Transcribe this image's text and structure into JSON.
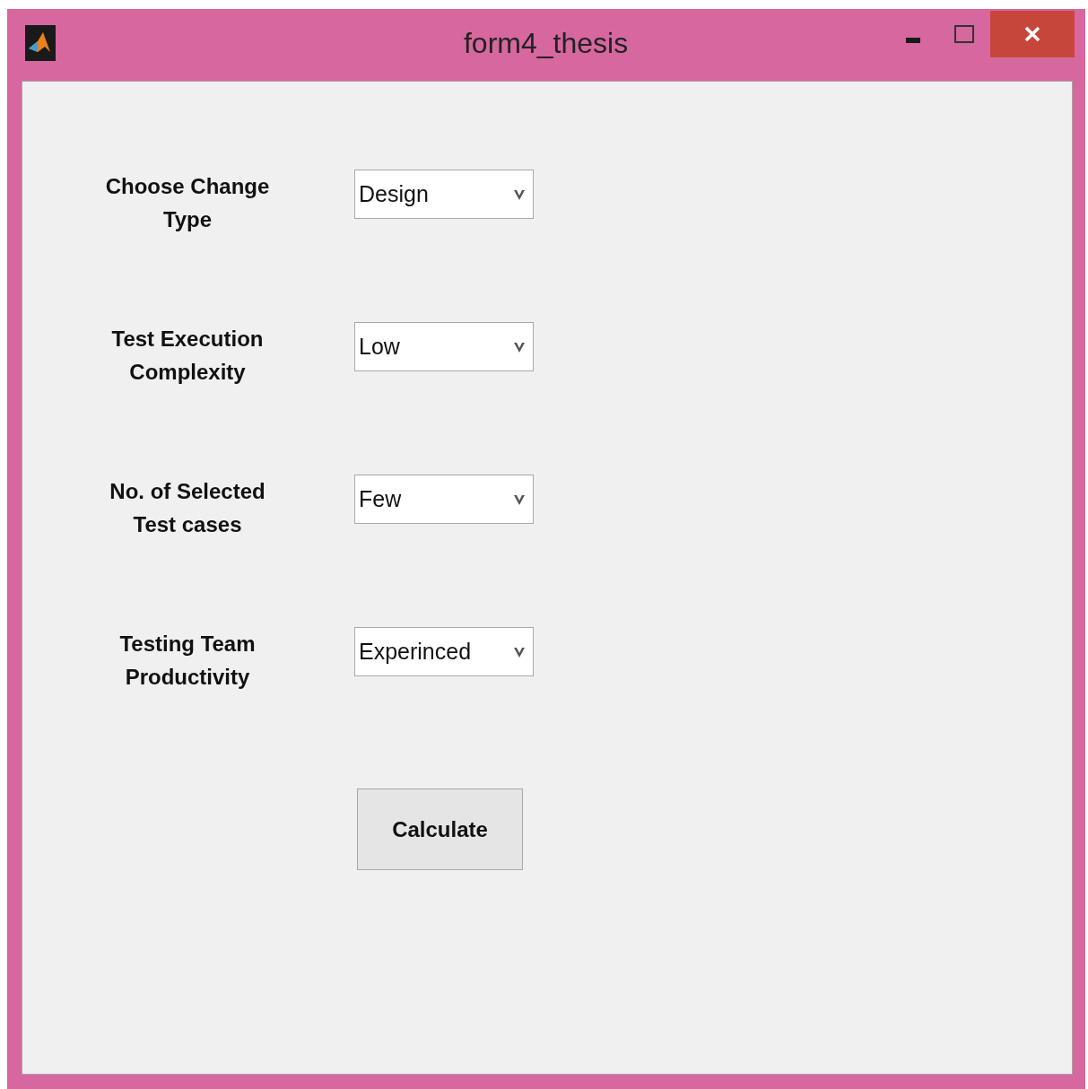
{
  "window": {
    "title": "form4_thesis"
  },
  "fields": [
    {
      "label": "Choose Change Type",
      "value": "Design"
    },
    {
      "label": "Test Execution Complexity",
      "value": "Low"
    },
    {
      "label": "No. of Selected Test cases",
      "value": "Few"
    },
    {
      "label": "Testing Team Productivity",
      "value": "Experinced"
    }
  ],
  "button": "Calculate"
}
